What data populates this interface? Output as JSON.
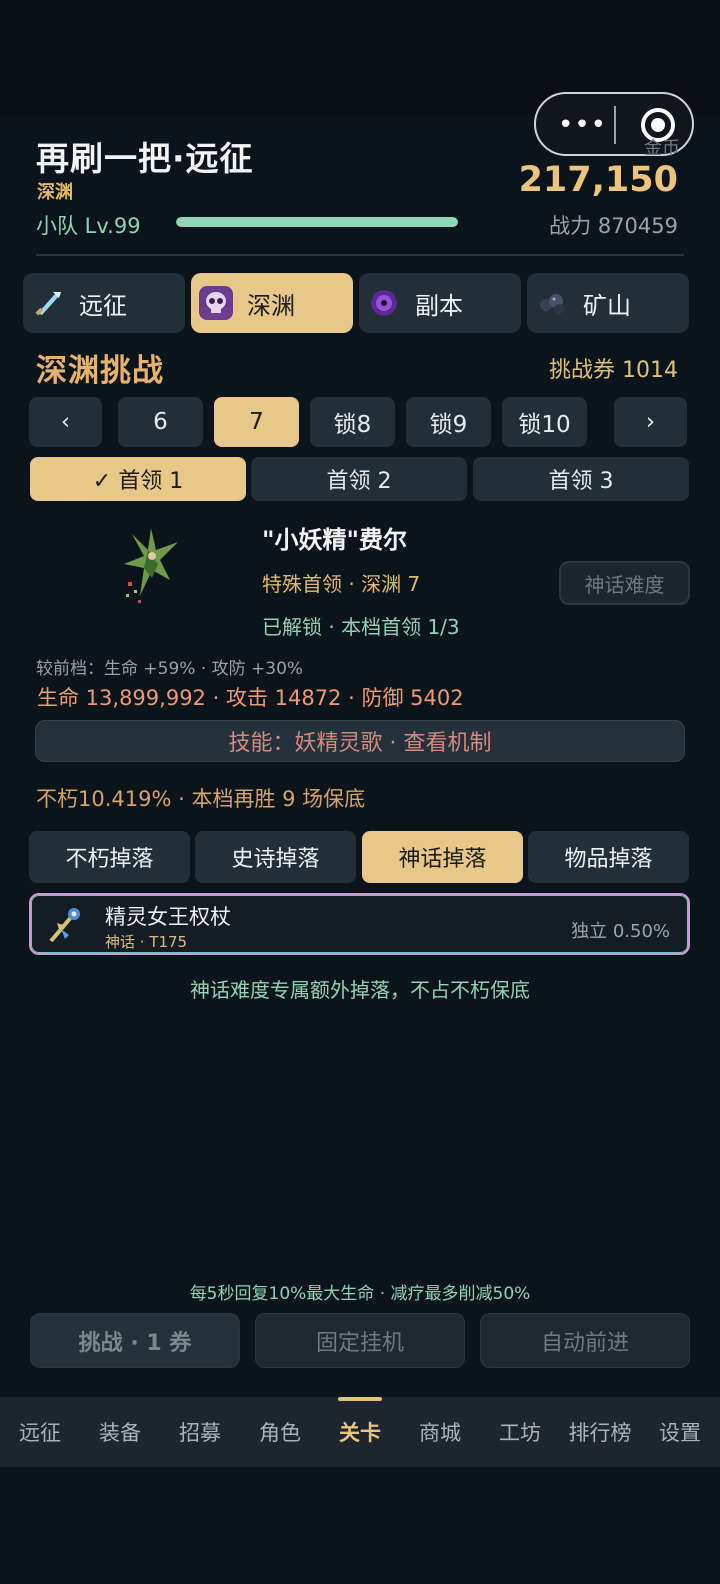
{
  "header": {
    "title": "再刷一把·远征",
    "subtitle": "深渊",
    "team_level": "小队 Lv.99",
    "xp_fraction": 1.0,
    "currency_label": "金币",
    "currency_value": "217,150",
    "power": "战力 870459"
  },
  "capsule": {
    "more_glyph": "•••"
  },
  "modes": [
    {
      "label": "远征",
      "icon": "crystal-sword-icon",
      "active": false
    },
    {
      "label": "深渊",
      "icon": "skull-icon",
      "active": true
    },
    {
      "label": "副本",
      "icon": "purple-vortex-icon",
      "active": false
    },
    {
      "label": "矿山",
      "icon": "ore-icon",
      "active": false
    }
  ],
  "challenge": {
    "title": "深渊挑战",
    "tickets": "挑战券 1014",
    "prev": "‹",
    "next": "›",
    "floors": [
      {
        "label": "6",
        "active": false
      },
      {
        "label": "7",
        "active": true
      },
      {
        "label": "锁8",
        "active": false
      },
      {
        "label": "锁9",
        "active": false
      },
      {
        "label": "锁10",
        "active": false
      }
    ],
    "boss_tabs": [
      "✓ 首领 1",
      "首领 2",
      "首领 3"
    ]
  },
  "boss": {
    "name": "\"小妖精\"费尔",
    "type": "特殊首领 · 深渊 7",
    "unlock": "已解锁 · 本档首领 1/3",
    "myth_button": "神话难度",
    "compare": "较前档：生命 +59% · 攻防 +30%",
    "stats": "生命 13,899,992 · 攻击 14872 · 防御 5402",
    "skill": "技能：妖精灵歌 · 查看机制",
    "guarantee": "不朽10.419% · 本档再胜 9 场保底"
  },
  "drops": {
    "tabs": [
      "不朽掉落",
      "史诗掉落",
      "神话掉落",
      "物品掉落"
    ],
    "active_tab": 2,
    "item": {
      "name": "精灵女王权杖",
      "sub": "神话 · T175",
      "rate": "独立 0.50%",
      "icon": "scepter-icon"
    },
    "note": "神话难度专属额外掉落，不占不朽保底"
  },
  "actions": {
    "regen": "每5秒回复10%最大生命 · 减疗最多削减50%",
    "challenge": "挑战 · 1 券",
    "idle": "固定挂机",
    "auto": "自动前进"
  },
  "nav": [
    "远征",
    "装备",
    "招募",
    "角色",
    "关卡",
    "商城",
    "工坊",
    "排行榜",
    "设置"
  ],
  "nav_active": 4,
  "colors": {
    "accent_gold": "#e8c888",
    "teal": "#8fd3b2",
    "panel": "#222f38",
    "background": "#0c141b"
  }
}
